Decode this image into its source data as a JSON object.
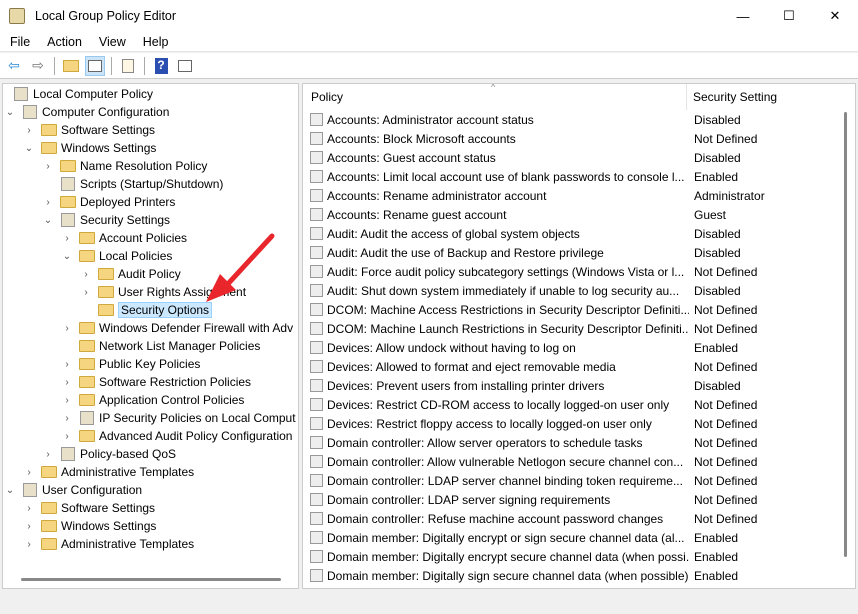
{
  "window": {
    "title": "Local Group Policy Editor",
    "minimize": "—",
    "maximize": "☐",
    "close": "✕"
  },
  "menu": [
    "File",
    "Action",
    "View",
    "Help"
  ],
  "toolbar": [
    "back-icon",
    "forward-icon",
    "up-folder-icon",
    "show-hide-tree-icon",
    "export-list-icon",
    "help-icon",
    "show-action-pane-icon"
  ],
  "tree": [
    {
      "label": "Local Computer Policy",
      "level": 0,
      "chev": "",
      "icon": "doc"
    },
    {
      "label": "Computer Configuration",
      "level": 0,
      "chev": "v",
      "icon": "doc"
    },
    {
      "label": "Software Settings",
      "level": 1,
      "chev": ">",
      "icon": "folder"
    },
    {
      "label": "Windows Settings",
      "level": 1,
      "chev": "v",
      "icon": "folder"
    },
    {
      "label": "Name Resolution Policy",
      "level": 2,
      "chev": ">",
      "icon": "folder"
    },
    {
      "label": "Scripts (Startup/Shutdown)",
      "level": 2,
      "chev": "",
      "icon": "doc"
    },
    {
      "label": "Deployed Printers",
      "level": 2,
      "chev": ">",
      "icon": "folder"
    },
    {
      "label": "Security Settings",
      "level": 2,
      "chev": "v",
      "icon": "doc"
    },
    {
      "label": "Account Policies",
      "level": 3,
      "chev": ">",
      "icon": "folder"
    },
    {
      "label": "Local Policies",
      "level": 3,
      "chev": "v",
      "icon": "folder"
    },
    {
      "label": "Audit Policy",
      "level": 4,
      "chev": ">",
      "icon": "folder"
    },
    {
      "label": "User Rights Assignment",
      "level": 4,
      "chev": ">",
      "icon": "folder"
    },
    {
      "label": "Security Options",
      "level": 4,
      "chev": "",
      "icon": "folder",
      "selected": true
    },
    {
      "label": "Windows Defender Firewall with Adv",
      "level": 3,
      "chev": ">",
      "icon": "folder"
    },
    {
      "label": "Network List Manager Policies",
      "level": 3,
      "chev": "",
      "icon": "folder"
    },
    {
      "label": "Public Key Policies",
      "level": 3,
      "chev": ">",
      "icon": "folder"
    },
    {
      "label": "Software Restriction Policies",
      "level": 3,
      "chev": ">",
      "icon": "folder"
    },
    {
      "label": "Application Control Policies",
      "level": 3,
      "chev": ">",
      "icon": "folder"
    },
    {
      "label": "IP Security Policies on Local Comput",
      "level": 3,
      "chev": ">",
      "icon": "doc"
    },
    {
      "label": "Advanced Audit Policy Configuration",
      "level": 3,
      "chev": ">",
      "icon": "folder"
    },
    {
      "label": "Policy-based QoS",
      "level": 2,
      "chev": ">",
      "icon": "doc"
    },
    {
      "label": "Administrative Templates",
      "level": 1,
      "chev": ">",
      "icon": "folder"
    },
    {
      "label": "User Configuration",
      "level": 0,
      "chev": "v",
      "icon": "doc"
    },
    {
      "label": "Software Settings",
      "level": 1,
      "chev": ">",
      "icon": "folder"
    },
    {
      "label": "Windows Settings",
      "level": 1,
      "chev": ">",
      "icon": "folder"
    },
    {
      "label": "Administrative Templates",
      "level": 1,
      "chev": ">",
      "icon": "folder"
    }
  ],
  "columns": {
    "policy": "Policy",
    "setting": "Security Setting",
    "sort_indicator": "^"
  },
  "policies": [
    [
      "Accounts: Administrator account status",
      "Disabled"
    ],
    [
      "Accounts: Block Microsoft accounts",
      "Not Defined"
    ],
    [
      "Accounts: Guest account status",
      "Disabled"
    ],
    [
      "Accounts: Limit local account use of blank passwords to console l...",
      "Enabled"
    ],
    [
      "Accounts: Rename administrator account",
      "Administrator"
    ],
    [
      "Accounts: Rename guest account",
      "Guest"
    ],
    [
      "Audit: Audit the access of global system objects",
      "Disabled"
    ],
    [
      "Audit: Audit the use of Backup and Restore privilege",
      "Disabled"
    ],
    [
      "Audit: Force audit policy subcategory settings (Windows Vista or l...",
      "Not Defined"
    ],
    [
      "Audit: Shut down system immediately if unable to log security au...",
      "Disabled"
    ],
    [
      "DCOM: Machine Access Restrictions in Security Descriptor Definiti...",
      "Not Defined"
    ],
    [
      "DCOM: Machine Launch Restrictions in Security Descriptor Definiti...",
      "Not Defined"
    ],
    [
      "Devices: Allow undock without having to log on",
      "Enabled"
    ],
    [
      "Devices: Allowed to format and eject removable media",
      "Not Defined"
    ],
    [
      "Devices: Prevent users from installing printer drivers",
      "Disabled"
    ],
    [
      "Devices: Restrict CD-ROM access to locally logged-on user only",
      "Not Defined"
    ],
    [
      "Devices: Restrict floppy access to locally logged-on user only",
      "Not Defined"
    ],
    [
      "Domain controller: Allow server operators to schedule tasks",
      "Not Defined"
    ],
    [
      "Domain controller: Allow vulnerable Netlogon secure channel con...",
      "Not Defined"
    ],
    [
      "Domain controller: LDAP server channel binding token requireme...",
      "Not Defined"
    ],
    [
      "Domain controller: LDAP server signing requirements",
      "Not Defined"
    ],
    [
      "Domain controller: Refuse machine account password changes",
      "Not Defined"
    ],
    [
      "Domain member: Digitally encrypt or sign secure channel data (al...",
      "Enabled"
    ],
    [
      "Domain member: Digitally encrypt secure channel data (when possi...",
      "Enabled"
    ],
    [
      "Domain member: Digitally sign secure channel data (when possible)",
      "Enabled"
    ]
  ],
  "annotation_color": "#e8262b"
}
